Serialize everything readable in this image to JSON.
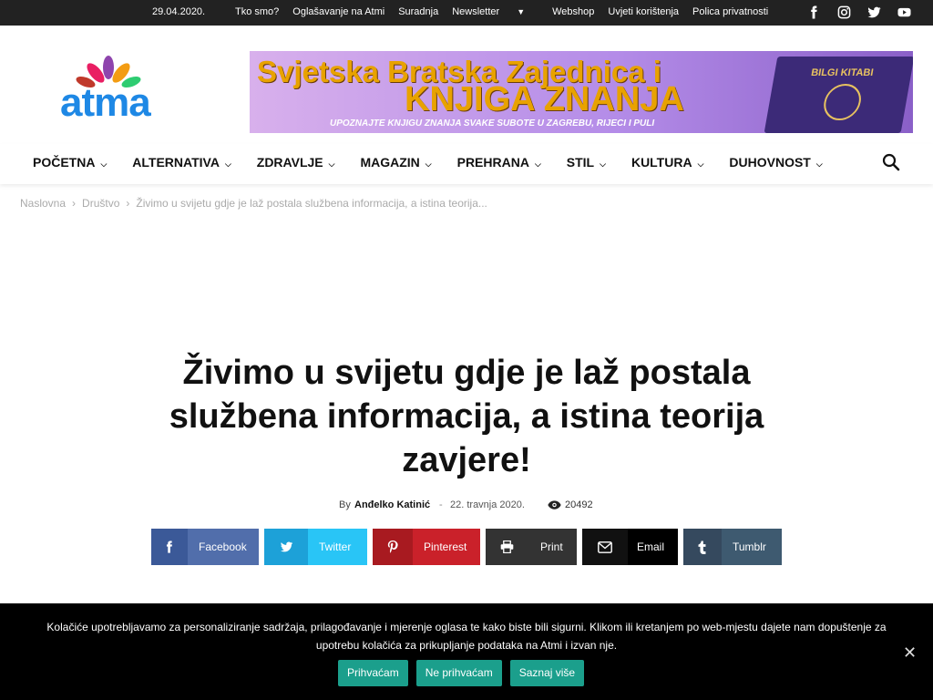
{
  "topbar": {
    "date": "29.04.2020.",
    "menu": [
      "Tko smo?",
      "Oglašavanje na Atmi",
      "Suradnja",
      "Newsletter",
      "Webshop",
      "Uvjeti korištenja",
      "Polica privatnosti"
    ],
    "socials": [
      "facebook-icon",
      "instagram-icon",
      "twitter-icon",
      "youtube-icon"
    ]
  },
  "logo": {
    "word": "atma"
  },
  "banner": {
    "line1": "Svjetska Bratska Zajednica i",
    "line2": "KNJIGA ZNANJA",
    "line3": "UPOZNAJTE KNJIGU ZNANJA SVAKE SUBOTE  U ZAGREBU, RIJECI I PULI",
    "book_title": "BILGI KITABI"
  },
  "nav": {
    "items": [
      "POČETNA",
      "ALTERNATIVA",
      "ZDRAVLJE",
      "MAGAZIN",
      "PREHRANA",
      "STIL",
      "KULTURA",
      "DUHOVNOST"
    ]
  },
  "breadcrumb": [
    "Naslovna",
    "Društvo",
    "Živimo u svijetu gdje je laž postala službena informacija, a istina teorija..."
  ],
  "article": {
    "title": "Živimo u svijetu gdje je laž postala službena informacija, a istina teorija zavjere!",
    "by": "By",
    "author": "Anđelko Katinić",
    "date": "22. travnja 2020.",
    "views": "20492"
  },
  "share": [
    {
      "label": "Facebook",
      "color": "#516eab",
      "icon_color": "#3b5998"
    },
    {
      "label": "Twitter",
      "color": "#29c5f6",
      "icon_color": "#1da1d8"
    },
    {
      "label": "Pinterest",
      "color": "#ca212a",
      "icon_color": "#a81a20"
    },
    {
      "label": "Print",
      "color": "#333333",
      "icon_color": "#333333"
    },
    {
      "label": "Email",
      "color": "#000000",
      "icon_color": "#111111"
    },
    {
      "label": "Tumblr",
      "color": "#3e5a70",
      "icon_color": "#35495e"
    }
  ],
  "cookie": {
    "text": "Kolačiće upotrebljavamo za personaliziranje sadržaja, prilagođavanje i mjerenje oglasa te kako biste bili sigurni. Klikom ili kretanjem po web-mjestu dajete nam dopuštenje za upotrebu kolačića za prikupljanje podataka na Atmi i izvan nje.",
    "accept": "Prihvaćam",
    "reject": "Ne prihvaćam",
    "more": "Saznaj više",
    "accent": "#1b9f8c"
  }
}
